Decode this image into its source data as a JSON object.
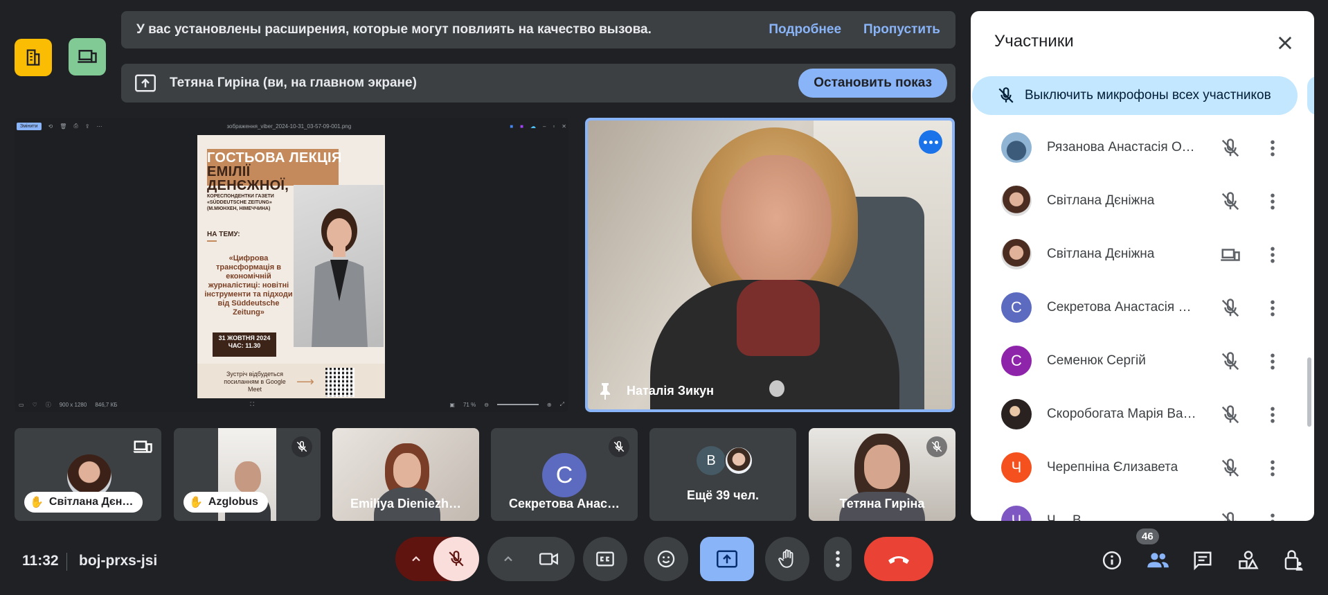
{
  "banners": {
    "extensions_message": "У вас установлены расширения, которые могут повлиять на качество вызова.",
    "learn_more": "Подробнее",
    "skip": "Пропустить",
    "presenting_message": "Тетяна Гиріна (ви, на главном экране)",
    "stop_presenting": "Остановить показ"
  },
  "shared_screen": {
    "toolbar_chip": "Змінити",
    "file_name": "зображення_viber_2024-10-31_03-57-09-001.png",
    "size_info": "900 x 1280",
    "file_size": "846,7 КБ",
    "zoom": "71 %",
    "poster": {
      "title_line1": "ГОСТЬОВА ЛЕКЦІЯ",
      "title_line2": "ЕМІЛІЇ",
      "title_line3": "ДЕНЄЖНОЇ,",
      "subtitle": "КОРЕСПОНДЕНТКИ ГАЗЕТИ «SÜDDEUTSCHE ZEITUNG» (М.МЮНХЕН, НІМЕЧЧИНА)",
      "topic_label": "НА ТЕМУ:",
      "quote": "«Цифрова трансформація в економічній журналістиці: новітні інструменти та підходи від Süddeutsche Zeitung»",
      "date": "31 ЖОВТНЯ 2024 ЧАС: 11.30",
      "footer": "Зустріч відбудеться посиланням в Google Meet"
    }
  },
  "speaker": {
    "name": "Наталія Зикун"
  },
  "thumbnails": [
    {
      "name": "Світлана Дєн…",
      "type": "photo-pill"
    },
    {
      "name": "Azglobus",
      "type": "photo-pill"
    },
    {
      "name": "Emiliya Dieniezh…",
      "type": "video"
    },
    {
      "name": "Секретова Анас…",
      "type": "letter",
      "letter": "С",
      "color": "#5c6bc0"
    },
    {
      "name": "Ещё 39 чел.",
      "type": "group",
      "letter": "В"
    },
    {
      "name": "Тетяна Гиріна",
      "type": "video"
    }
  ],
  "panel": {
    "title": "Участники",
    "mute_all": "Выключить микрофоны всех участников",
    "participants": [
      {
        "name": "Рязанова Анастасія Ол…",
        "avatar": "photo",
        "status": "mic-off"
      },
      {
        "name": "Світлана Дєніжна",
        "avatar": "photo",
        "status": "mic-off"
      },
      {
        "name": "Світлана Дєніжна",
        "avatar": "photo",
        "status": "presenting"
      },
      {
        "name": "Секретова Анастасія …",
        "avatar": "letter",
        "letter": "С",
        "color": "#5c6bc0",
        "status": "mic-off"
      },
      {
        "name": "Семенюк Сергій",
        "avatar": "letter",
        "letter": "С",
        "color": "#8e24aa",
        "status": "mic-off"
      },
      {
        "name": "Скоробогата Марія Ва…",
        "avatar": "photo",
        "status": "mic-off"
      },
      {
        "name": "Черепніна Єлизавета",
        "avatar": "letter",
        "letter": "Ч",
        "color": "#f4511e",
        "status": "mic-off"
      },
      {
        "name": "Ч… В…",
        "avatar": "letter",
        "letter": "Ч",
        "color": "#7e57c2",
        "status": "mic-off"
      }
    ]
  },
  "bottom": {
    "time": "11:32",
    "meeting_code": "boj-prxs-jsi",
    "participants_count": "46"
  },
  "colors": {
    "accent": "#8ab4f8",
    "hangup": "#ea4335",
    "mic_off_red": "#f9dedc",
    "dark_red": "#601410"
  }
}
